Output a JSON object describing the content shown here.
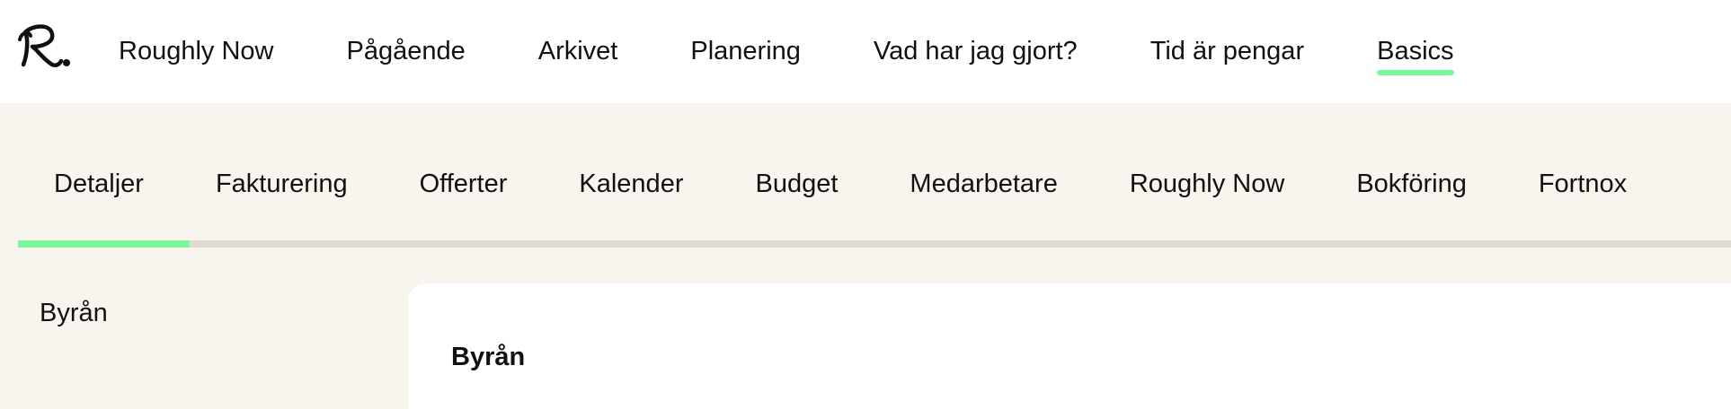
{
  "topnav": {
    "items": [
      {
        "label": "Roughly Now"
      },
      {
        "label": "Pågående"
      },
      {
        "label": "Arkivet"
      },
      {
        "label": "Planering"
      },
      {
        "label": "Vad har jag gjort?"
      },
      {
        "label": "Tid är pengar"
      },
      {
        "label": "Basics"
      }
    ],
    "active": "Basics"
  },
  "subnav": {
    "tabs": [
      {
        "label": "Detaljer"
      },
      {
        "label": "Fakturering"
      },
      {
        "label": "Offerter"
      },
      {
        "label": "Kalender"
      },
      {
        "label": "Budget"
      },
      {
        "label": "Medarbetare"
      },
      {
        "label": "Roughly Now"
      },
      {
        "label": "Bokföring"
      },
      {
        "label": "Fortnox"
      }
    ],
    "active": "Detaljer"
  },
  "sidebar": {
    "title": "Byrån"
  },
  "main": {
    "card_title": "Byrån"
  },
  "colors": {
    "accent": "#7cf59b",
    "page_background": "#f7f5ee",
    "track": "#dedcd1"
  },
  "icons": {
    "logo": "roughly-now-script-logo"
  }
}
